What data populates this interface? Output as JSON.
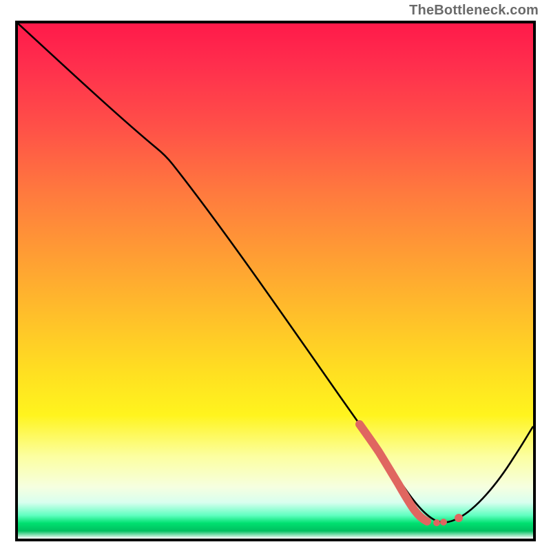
{
  "watermark": "TheBottleneck.com",
  "chart_data": {
    "type": "line",
    "title": "",
    "xlabel": "",
    "ylabel": "",
    "xlim": [
      0,
      100
    ],
    "ylim": [
      0,
      100
    ],
    "series": [
      {
        "name": "bottleneck-curve",
        "x": [
          0,
          10,
          20,
          27,
          35,
          45,
          55,
          64,
          67,
          70,
          72,
          74,
          76,
          78,
          80,
          82,
          85,
          90,
          95,
          100
        ],
        "y": [
          100,
          91,
          82,
          76,
          66,
          53,
          39,
          26,
          22,
          17,
          13,
          9,
          6,
          4,
          3,
          3,
          4,
          12,
          24,
          38
        ]
      }
    ],
    "annotations": {
      "highlight_region_x": [
        67,
        82
      ],
      "highlight_color": "#e06660",
      "background_gradient": {
        "top": "#ff1a4a",
        "mid_upper": "#ffa033",
        "mid_lower": "#fff41e",
        "bottom": "#00e070"
      }
    }
  },
  "colors": {
    "border": "#000000",
    "curve": "#000000",
    "highlight": "#e06660",
    "watermark": "#6a6a6a"
  }
}
